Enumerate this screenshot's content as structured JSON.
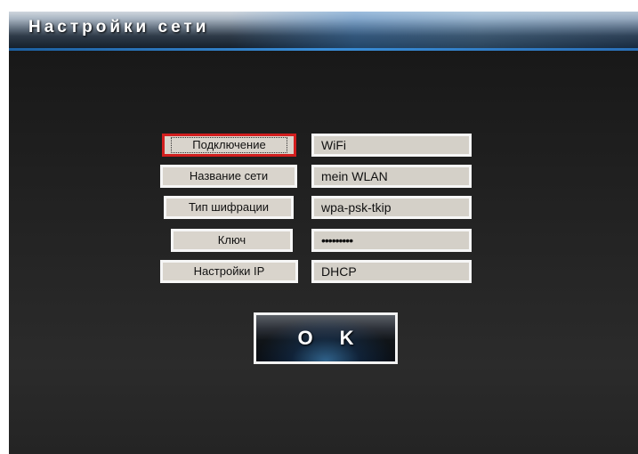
{
  "window": {
    "title": "Настройки сети"
  },
  "form": {
    "rows": [
      {
        "label": "Подключение",
        "value": "WiFi"
      },
      {
        "label": "Название сети",
        "value": "mein WLAN"
      },
      {
        "label": "Тип шифрации",
        "value": "wpa-psk-tkip"
      },
      {
        "label": "Ключ",
        "value": "•••••••••"
      },
      {
        "label": "Настройки IP",
        "value": "DHCP"
      }
    ]
  },
  "ok_button": {
    "label": "O K"
  },
  "colors": {
    "selected_border": "#d21f1f",
    "field_bg": "#d4d0c8",
    "accent_blue": "#3a8ed8"
  }
}
